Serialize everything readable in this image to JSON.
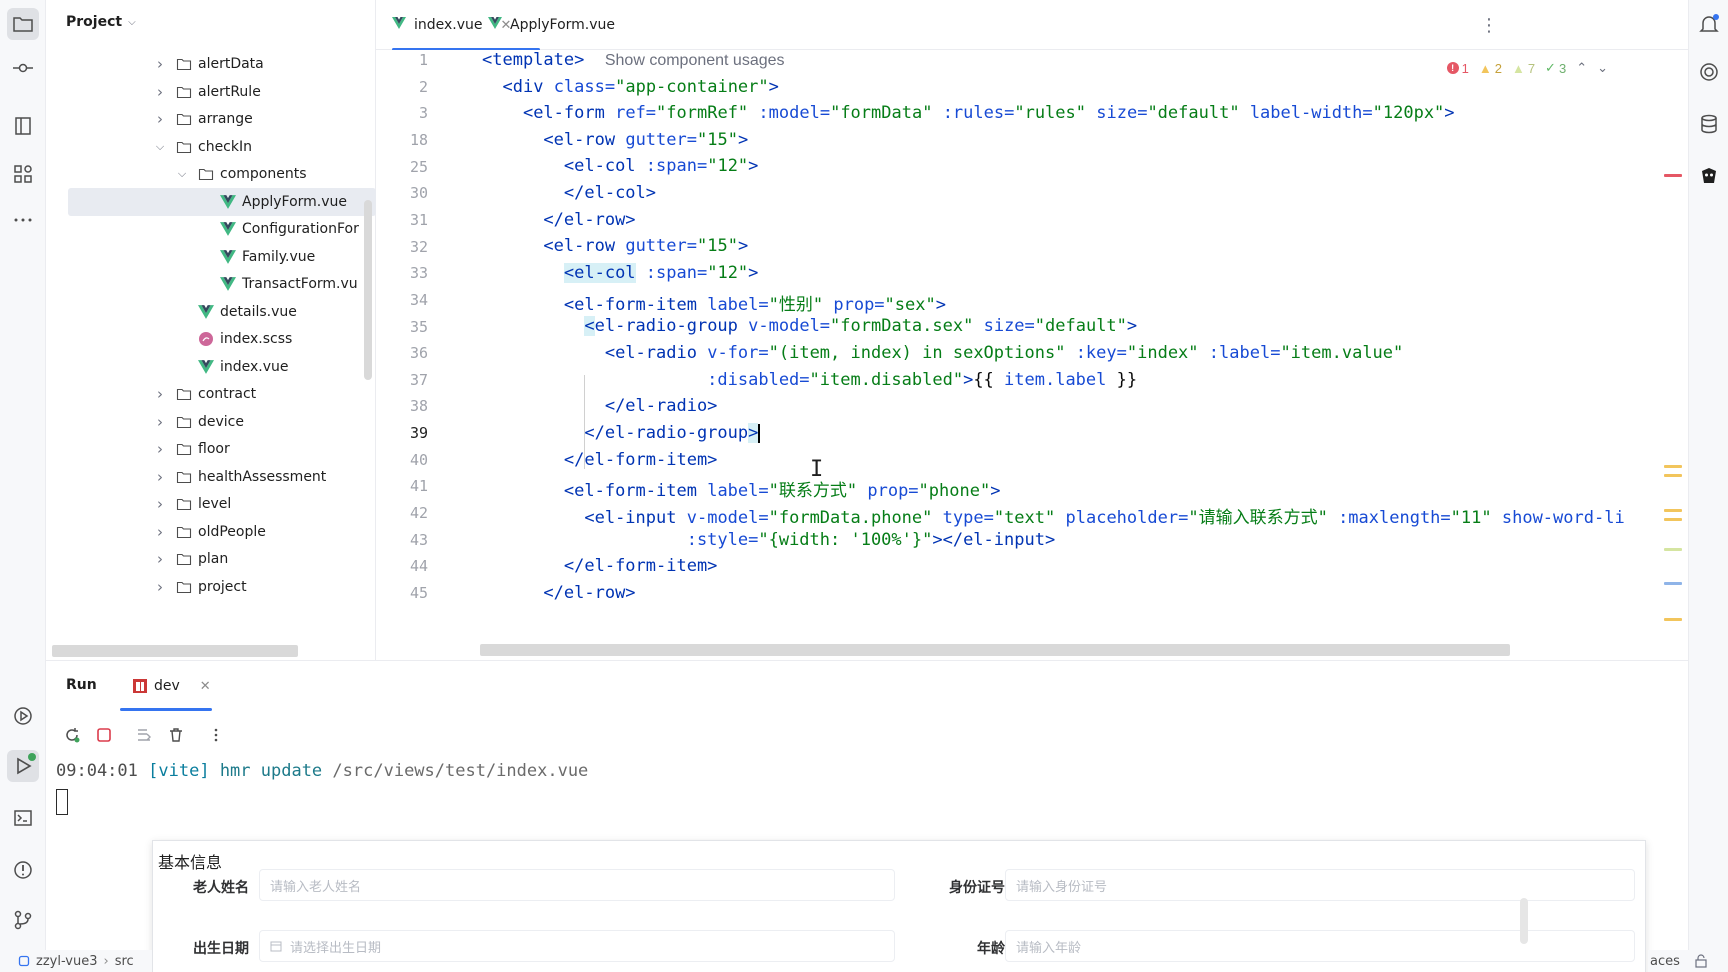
{
  "project_panel": {
    "title": "Project",
    "tree": [
      {
        "label": "alertData",
        "type": "folder",
        "expanded": false
      },
      {
        "label": "alertRule",
        "type": "folder",
        "expanded": false
      },
      {
        "label": "arrange",
        "type": "folder",
        "expanded": false
      },
      {
        "label": "checkIn",
        "type": "folder",
        "expanded": true
      },
      {
        "label": "components",
        "type": "folder",
        "expanded": true
      },
      {
        "label": "ApplyForm.vue",
        "type": "vue",
        "selected": true
      },
      {
        "label": "ConfigurationFor",
        "type": "vue"
      },
      {
        "label": "Family.vue",
        "type": "vue"
      },
      {
        "label": "TransactForm.vu",
        "type": "vue"
      },
      {
        "label": "details.vue",
        "type": "vue"
      },
      {
        "label": "index.scss",
        "type": "scss"
      },
      {
        "label": "index.vue",
        "type": "vue"
      },
      {
        "label": "contract",
        "type": "folder",
        "expanded": false
      },
      {
        "label": "device",
        "type": "folder",
        "expanded": false
      },
      {
        "label": "floor",
        "type": "folder",
        "expanded": false
      },
      {
        "label": "healthAssessment",
        "type": "folder",
        "expanded": false
      },
      {
        "label": "level",
        "type": "folder",
        "expanded": false
      },
      {
        "label": "oldPeople",
        "type": "folder",
        "expanded": false
      },
      {
        "label": "plan",
        "type": "folder",
        "expanded": false
      },
      {
        "label": "project",
        "type": "folder",
        "expanded": false
      }
    ]
  },
  "editor": {
    "tabs": [
      {
        "label": "index.vue",
        "active": true
      },
      {
        "label": "ApplyForm.vue",
        "active": false
      }
    ],
    "inspections": {
      "errors": "1",
      "warnings": "2",
      "weak_warnings": "7",
      "ok": "3"
    },
    "template_hint": "Show component usages",
    "line_numbers": [
      "1",
      "2",
      "3",
      "18",
      "25",
      "30",
      "31",
      "32",
      "33",
      "34",
      "35",
      "36",
      "37",
      "38",
      "39",
      "40",
      "41",
      "42",
      "43",
      "44",
      "45"
    ],
    "current_line": "39"
  },
  "run_panel": {
    "title": "Run",
    "tab_label": "dev",
    "console": {
      "time": "09:04:01",
      "tag": "[vite]",
      "cmd": "hmr update",
      "path": "/src/views/test/index.vue"
    }
  },
  "preview": {
    "section_title": "基本信息",
    "fields": [
      {
        "label": "老人姓名",
        "placeholder": "请输入老人姓名"
      },
      {
        "label": "身份证号",
        "placeholder": "请输入身份证号"
      },
      {
        "label": "出生日期",
        "placeholder": "请选择出生日期"
      },
      {
        "label": "年龄",
        "placeholder": "请输入年龄"
      }
    ]
  },
  "status_bar": {
    "project": "zzyl-vue3",
    "path": "src",
    "right_text": "aces"
  },
  "colors": {
    "accent": "#3574f0",
    "vue_green": "#41b883",
    "tag": "#0033b3",
    "attribute": "#174ad4",
    "string": "#067d17"
  }
}
